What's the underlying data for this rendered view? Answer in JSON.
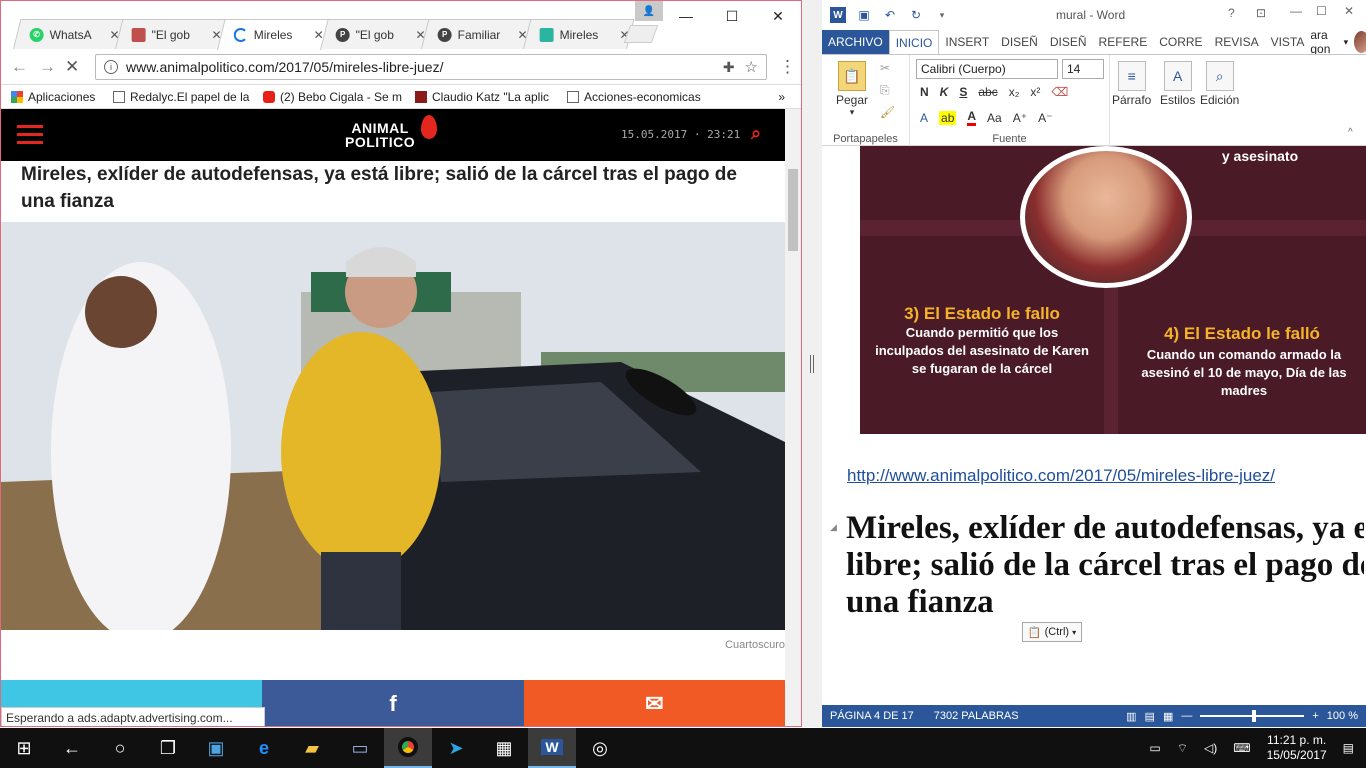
{
  "chrome": {
    "tabs": [
      {
        "title": "WhatsA",
        "icon_color": "#25d366"
      },
      {
        "title": "\"El gob",
        "icon_color": "#c0504d"
      },
      {
        "title": "Mireles",
        "icon_color": "#1a73e8"
      },
      {
        "title": "\"El gob",
        "icon_color": "#444444"
      },
      {
        "title": "Familiar",
        "icon_color": "#444444"
      },
      {
        "title": "Mireles",
        "icon_color": "#2bb5a0"
      }
    ],
    "url": "www.animalpolitico.com/2017/05/mireles-libre-juez/",
    "bookmarks": [
      {
        "label": "Aplicaciones"
      },
      {
        "label": "Redalyc.El papel de la"
      },
      {
        "label": "(2) Bebo Cigala - Se m"
      },
      {
        "label": "Claudio Katz \"La aplic"
      },
      {
        "label": "Acciones-economicas"
      }
    ],
    "status": "Esperando a ads.adaptv.advertising.com..."
  },
  "site": {
    "logo_top": "ANIMAL",
    "logo_bottom": "POLITICO",
    "date": "15.05.2017 · 23:21",
    "headline": "Mireles, exlíder de autodefensas, ya está libre; salió de la cárcel tras el pago de una fianza",
    "photo_credit": "Cuartoscuro",
    "share": {
      "twitter": "",
      "facebook": "f",
      "email": "✉"
    }
  },
  "word": {
    "title": "mural - Word",
    "help": "?",
    "tabs": {
      "file": "ARCHIVO",
      "home": "INICIO",
      "insert": "INSERT",
      "design": "DISEÑ",
      "layout": "DISEÑ",
      "references": "REFERE",
      "mailings": "CORRE",
      "review": "REVISA",
      "view": "VISTA"
    },
    "user": "ara gon",
    "ribbon": {
      "paste": "Pegar",
      "clipboard_group": "Portapapeles",
      "font_name": "Calibri (Cuerpo)",
      "font_size": "14",
      "font_group": "Fuente",
      "paragraph": "Párrafo",
      "styles": "Estilos",
      "editing": "Edición"
    },
    "infographic": {
      "top_caption": "y asesinato",
      "panel3_number": "3) El Estado le fallo",
      "panel3_text": "Cuando permitió que los inculpados del asesinato de Karen se fugaran de la cárcel",
      "panel4_number": "4) El Estado le falló",
      "panel4_text": "Cuando un comando armado la asesinó el 10 de mayo, Día de las madres"
    },
    "link": "http://www.animalpolitico.com/2017/05/mireles-libre-juez/",
    "heading_lines": [
      "Mireles, exlíder de autodefensas, ya está",
      "libre; salió de la cárcel tras el pago de",
      "una fianza"
    ],
    "paste_options": "(Ctrl)",
    "status": {
      "page": "PÁGINA 4 DE 17",
      "words": "7302 PALABRAS",
      "zoom": "100 %"
    }
  },
  "taskbar": {
    "time": "11:21 p. m.",
    "date": "15/05/2017"
  }
}
